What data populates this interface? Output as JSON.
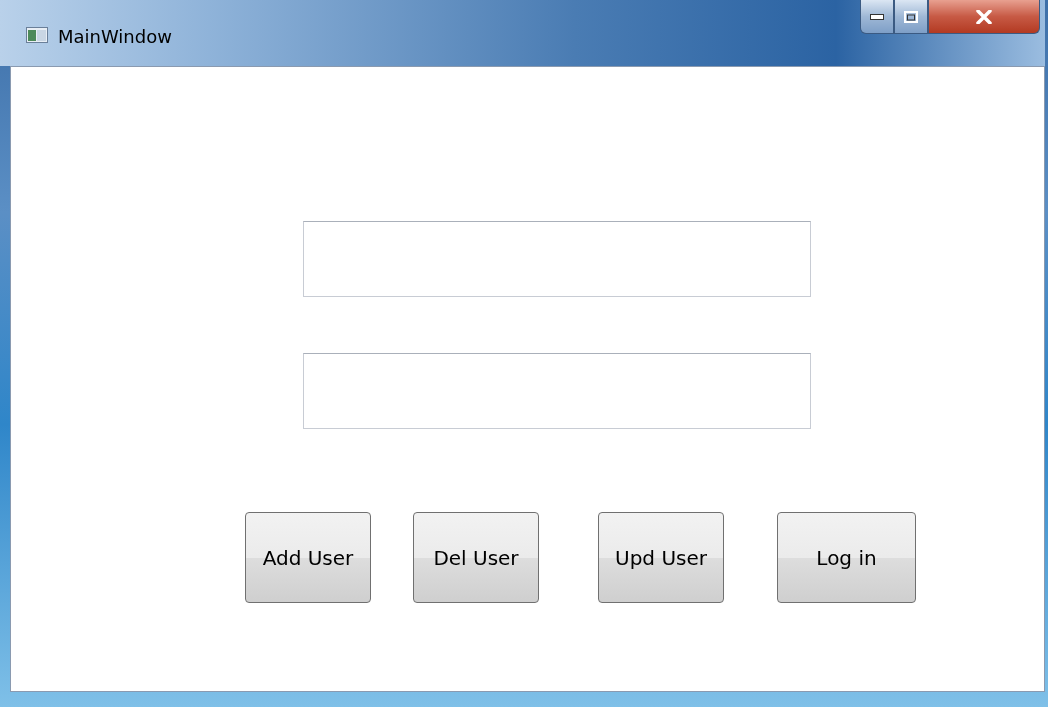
{
  "window": {
    "title": "MainWindow"
  },
  "fields": [
    {
      "kind": "textbox"
    },
    {
      "kind": "textbox"
    }
  ],
  "buttons": [
    "Add User",
    "Del User",
    "Upd User",
    "Log in"
  ]
}
